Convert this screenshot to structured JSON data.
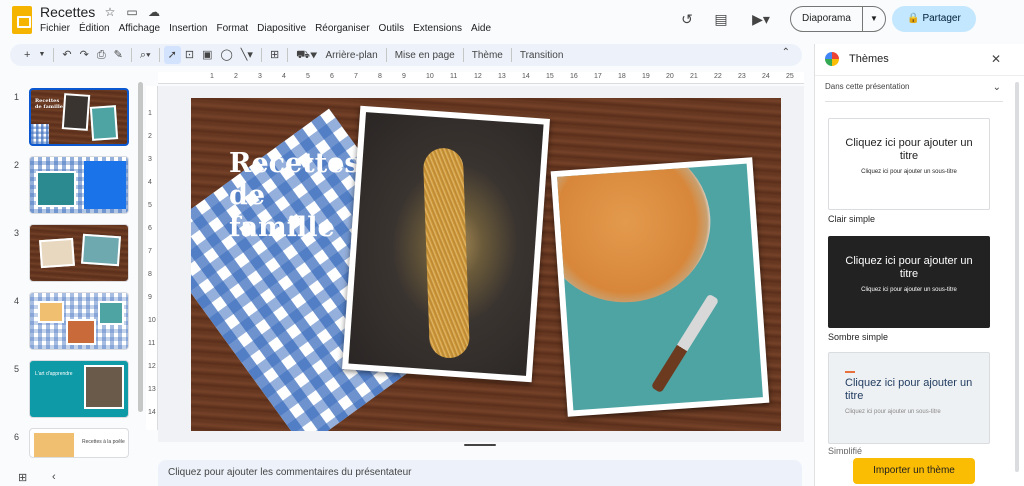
{
  "header": {
    "doc_title": "Recettes",
    "menus": [
      "Fichier",
      "Édition",
      "Affichage",
      "Insertion",
      "Format",
      "Diapositive",
      "Réorganiser",
      "Outils",
      "Extensions",
      "Aide"
    ],
    "slideshow_label": "Diaporama",
    "share_label": "Partager"
  },
  "toolbar": {
    "background_label": "Arrière-plan",
    "layout_label": "Mise en page",
    "theme_label": "Thème",
    "transition_label": "Transition"
  },
  "ruler": {
    "h_ticks": [
      "1",
      "2",
      "3",
      "4",
      "5",
      "6",
      "7",
      "8",
      "9",
      "10",
      "11",
      "12",
      "13",
      "14",
      "15",
      "16",
      "17",
      "18",
      "19",
      "20",
      "21",
      "22",
      "23",
      "24",
      "25"
    ],
    "v_ticks": [
      "1",
      "2",
      "3",
      "4",
      "5",
      "6",
      "7",
      "8",
      "9",
      "10",
      "11",
      "12",
      "13",
      "14"
    ]
  },
  "filmstrip": {
    "slides": [
      {
        "num": "1",
        "caption": "Recettes de famille",
        "selected": true
      },
      {
        "num": "2",
        "caption": "",
        "selected": false
      },
      {
        "num": "3",
        "caption": "",
        "selected": false
      },
      {
        "num": "4",
        "caption": "",
        "selected": false
      },
      {
        "num": "5",
        "caption": "L'art d'apprendre",
        "selected": false
      },
      {
        "num": "6",
        "caption": "Recettes à la poêle",
        "selected": false
      }
    ]
  },
  "slide": {
    "title": "Recettes de famille"
  },
  "notes": {
    "placeholder": "Cliquez pour ajouter les commentaires du présentateur"
  },
  "themes_panel": {
    "title": "Thèmes",
    "dropdown_label": "Dans cette présentation",
    "cards": [
      {
        "title": "Cliquez ici pour ajouter un titre",
        "subtitle": "Cliquez ici pour ajouter un sous-titre",
        "name": "Clair simple"
      },
      {
        "title": "Cliquez ici pour ajouter un titre",
        "subtitle": "Cliquez ici pour ajouter un sous-titre",
        "name": "Sombre simple"
      },
      {
        "title": "Cliquez ici pour ajouter un titre",
        "subtitle": "Cliquez ici pour ajouter un sous-titre",
        "name": "Simplifié"
      }
    ],
    "import_label": "Importer un thème"
  },
  "colors": {
    "accent_blue": "#0b57d0",
    "share_bg": "#c2e7ff",
    "import_bg": "#fbbc04",
    "doc_icon": "#f4b400"
  }
}
